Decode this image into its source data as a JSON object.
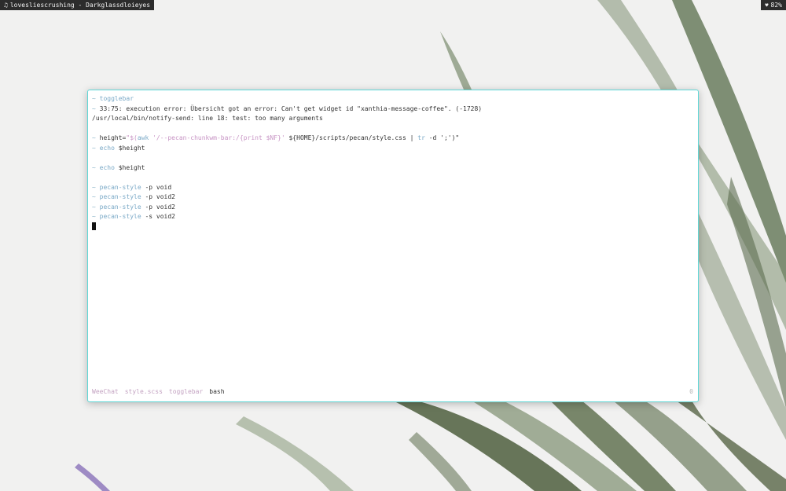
{
  "topbar": {
    "note_icon": "music-note-icon",
    "now_playing": "lovesliescrushing - Darkglassdloieyes",
    "heart_icon": "heart-icon",
    "battery": "82%"
  },
  "terminal": {
    "line1": {
      "prompt": "~",
      "cmd": "togglebar"
    },
    "line2": {
      "prompt": "~",
      "text": "33:75: execution error: Übersicht got an error: Can't get widget id \"xanthia-message-coffee\". (-1728)"
    },
    "line3": {
      "text": "/usr/local/bin/notify-send: line 18: test: too many arguments"
    },
    "line5": {
      "prompt": "~",
      "p1": "height=",
      "p2": "\"$(",
      "p3": "awk",
      "p4": " '/--pecan-chunkwm-bar:/{print $NF}'",
      "p5": " ${HOME}/scripts/pecan/style.css | ",
      "p6": "tr",
      "p7": " -d ';')\""
    },
    "line6": {
      "prompt": "~",
      "cmd": "echo",
      "arg": " $height"
    },
    "line8": {
      "prompt": "~",
      "cmd": "echo",
      "arg": " $height"
    },
    "line10": {
      "prompt": "~",
      "cmd": "pecan-style",
      "arg": " -p void"
    },
    "line11": {
      "prompt": "~",
      "cmd": "pecan-style",
      "arg": " -p void2"
    },
    "line12": {
      "prompt": "~",
      "cmd": "pecan-style",
      "arg": " -p void2"
    },
    "line13": {
      "prompt": "~",
      "cmd": "pecan-style",
      "arg": " -s void2"
    }
  },
  "statusbar": {
    "windows": [
      "WeeChat",
      "style.scss",
      "togglebar",
      "bash"
    ],
    "active_index": 3,
    "right": "0"
  },
  "colors": {
    "accent_border": "#5fd7d6",
    "prompt": "#8ab4c8",
    "command": "#7aa9c7",
    "string": "#c895c5",
    "statusbar_inactive": "#c4a3c2"
  }
}
